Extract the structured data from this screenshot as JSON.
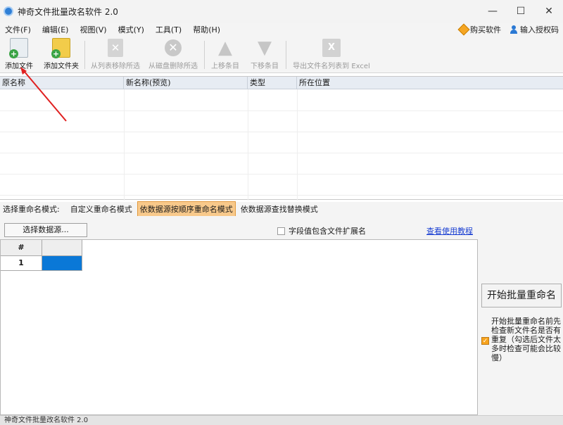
{
  "window": {
    "title": "神奇文件批量改名软件 2.0",
    "controls": [
      "—",
      "☐",
      "✕"
    ]
  },
  "menu": {
    "items": [
      "文件(F)",
      "编辑(E)",
      "视图(V)",
      "模式(Y)",
      "工具(T)",
      "帮助(H)"
    ],
    "buy": "购买软件",
    "license": "输入授权码"
  },
  "toolbar": {
    "add_file": "添加文件",
    "add_folder": "添加文件夹",
    "remove_from_list": "从列表移除所选",
    "delete_from_disk": "从磁盘删除所选",
    "move_up": "上移条目",
    "move_down": "下移条目",
    "export_excel": "导出文件名列表到 Excel"
  },
  "file_table": {
    "columns": [
      "原名称",
      "新名称(预览)",
      "类型",
      "所在位置"
    ]
  },
  "mode_bar": {
    "label": "选择重命名模式:",
    "tabs": [
      "自定义重命名模式",
      "依数据源按顺序重命名模式",
      "依数据源查找替换模式"
    ],
    "active_index": 1
  },
  "panel": {
    "select_source": "选择数据源...",
    "include_ext": "字段值包含文件扩展名",
    "include_ext_checked": false,
    "tutorial": "查看使用教程",
    "grid": {
      "header": "#",
      "row_number": "1"
    },
    "start_button": "开始批量重命名",
    "check_duplicates": "开始批量重命名前先检查新文件名是否有重复（勾选后文件太多时检查可能会比较慢）",
    "check_duplicates_checked": true
  },
  "statusbar": {
    "text": "神奇文件批量改名软件 2.0"
  },
  "colors": {
    "active_tab": "#f8c98b",
    "selection": "#0a78d7",
    "link": "#1a3fd2",
    "annotation_arrow": "#e02020"
  }
}
